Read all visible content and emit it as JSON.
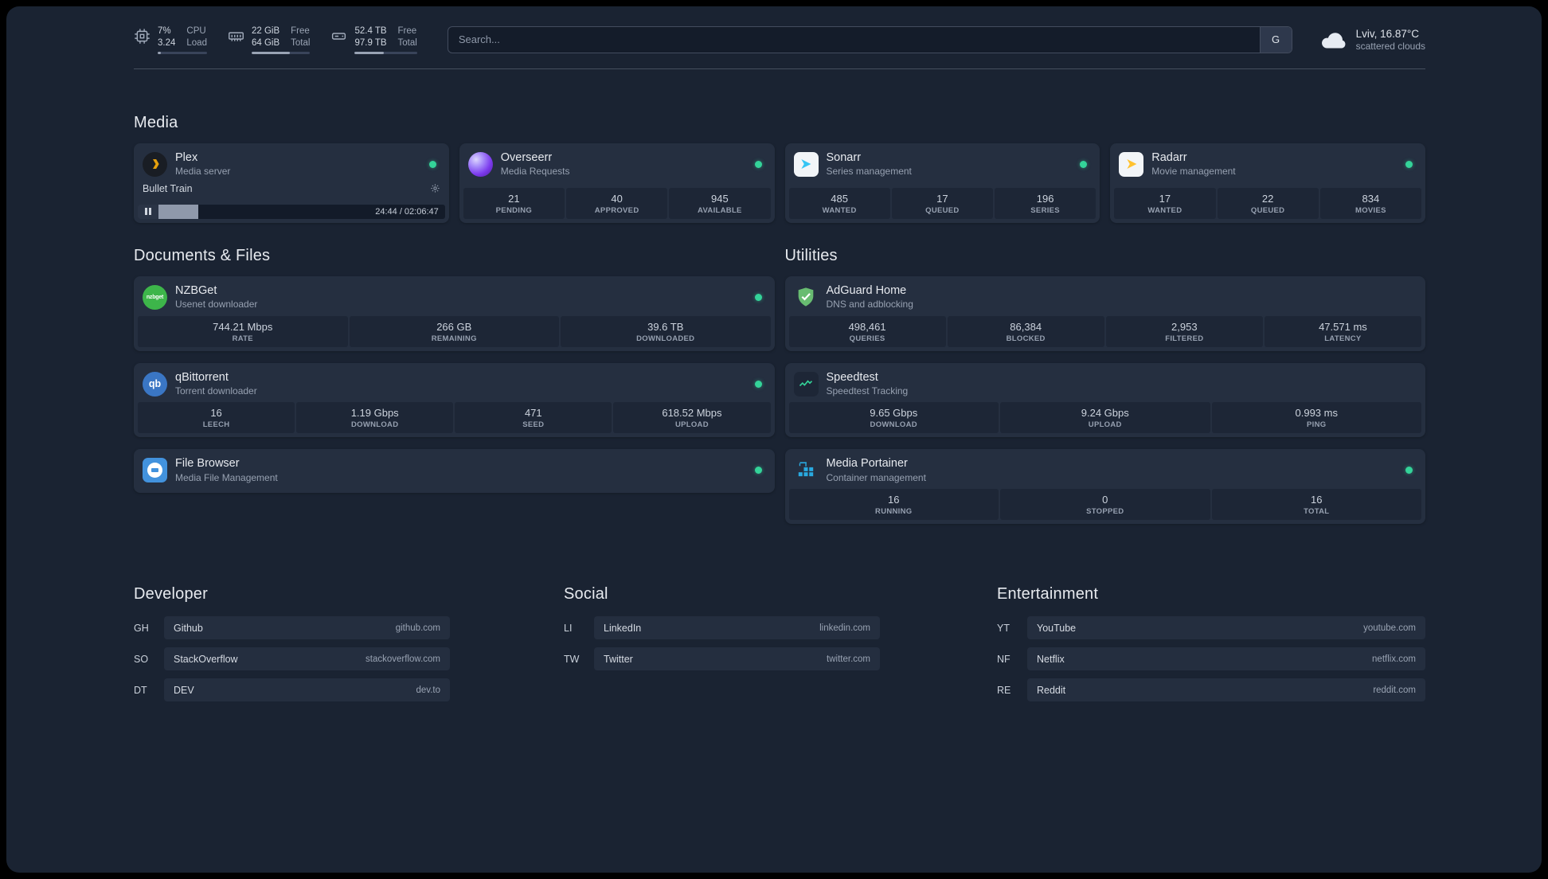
{
  "colors": {
    "status_online": "#34d399",
    "accent_plex": "#e5a00d",
    "accent_radarr": "#ffc230",
    "accent_sonarr": "#35c5f4",
    "accent_adguard": "#68bc71",
    "accent_portainer": "#29aae1",
    "accent_nzbget": "#3db54a",
    "accent_qbittorrent": "#3a76c4",
    "accent_filebrowser": "#4292dd"
  },
  "topbar": {
    "cpu": {
      "value_top": "7%",
      "value_bottom": "3.24",
      "label_top": "CPU",
      "label_bottom": "Load",
      "percent": 7
    },
    "memory": {
      "value_top": "22 GiB",
      "value_bottom": "64 GiB",
      "label_top": "Free",
      "label_bottom": "Total",
      "percent": 65
    },
    "disk": {
      "value_top": "52.4 TB",
      "value_bottom": "97.9 TB",
      "label_top": "Free",
      "label_bottom": "Total",
      "percent": 46
    },
    "search": {
      "placeholder": "Search...",
      "provider_button": "G"
    },
    "weather": {
      "location": "Lviv, 16.87°C",
      "condition": "scattered clouds"
    }
  },
  "sections": {
    "media": "Media",
    "documents": "Documents & Files",
    "utilities": "Utilities"
  },
  "services": {
    "plex": {
      "name": "Plex",
      "desc": "Media server",
      "now_playing": "Bullet Train",
      "elapsed": "24:44 / 02:06:47",
      "progress_percent": 19
    },
    "overseerr": {
      "name": "Overseerr",
      "desc": "Media Requests",
      "stats": [
        {
          "value": "21",
          "label": "PENDING"
        },
        {
          "value": "40",
          "label": "APPROVED"
        },
        {
          "value": "945",
          "label": "AVAILABLE"
        }
      ]
    },
    "sonarr": {
      "name": "Sonarr",
      "desc": "Series management",
      "stats": [
        {
          "value": "485",
          "label": "WANTED"
        },
        {
          "value": "17",
          "label": "QUEUED"
        },
        {
          "value": "196",
          "label": "SERIES"
        }
      ]
    },
    "radarr": {
      "name": "Radarr",
      "desc": "Movie management",
      "stats": [
        {
          "value": "17",
          "label": "WANTED"
        },
        {
          "value": "22",
          "label": "QUEUED"
        },
        {
          "value": "834",
          "label": "MOVIES"
        }
      ]
    },
    "nzbget": {
      "name": "NZBGet",
      "desc": "Usenet downloader",
      "icon_text": "nzbget",
      "stats": [
        {
          "value": "744.21 Mbps",
          "label": "RATE"
        },
        {
          "value": "266 GB",
          "label": "REMAINING"
        },
        {
          "value": "39.6 TB",
          "label": "DOWNLOADED"
        }
      ]
    },
    "qbittorrent": {
      "name": "qBittorrent",
      "desc": "Torrent downloader",
      "icon_text": "qb",
      "stats": [
        {
          "value": "16",
          "label": "LEECH"
        },
        {
          "value": "1.19 Gbps",
          "label": "DOWNLOAD"
        },
        {
          "value": "471",
          "label": "SEED"
        },
        {
          "value": "618.52 Mbps",
          "label": "UPLOAD"
        }
      ]
    },
    "filebrowser": {
      "name": "File Browser",
      "desc": "Media File Management"
    },
    "adguard": {
      "name": "AdGuard Home",
      "desc": "DNS and adblocking",
      "stats": [
        {
          "value": "498,461",
          "label": "QUERIES"
        },
        {
          "value": "86,384",
          "label": "BLOCKED"
        },
        {
          "value": "2,953",
          "label": "FILTERED"
        },
        {
          "value": "47.571 ms",
          "label": "LATENCY"
        }
      ]
    },
    "speedtest": {
      "name": "Speedtest",
      "desc": "Speedtest Tracking",
      "stats": [
        {
          "value": "9.65 Gbps",
          "label": "DOWNLOAD"
        },
        {
          "value": "9.24 Gbps",
          "label": "UPLOAD"
        },
        {
          "value": "0.993 ms",
          "label": "PING"
        }
      ]
    },
    "portainer": {
      "name": "Media Portainer",
      "desc": "Container management",
      "stats": [
        {
          "value": "16",
          "label": "RUNNING"
        },
        {
          "value": "0",
          "label": "STOPPED"
        },
        {
          "value": "16",
          "label": "TOTAL"
        }
      ]
    }
  },
  "bookmarks": {
    "developer": {
      "title": "Developer",
      "items": [
        {
          "abbr": "GH",
          "name": "Github",
          "url": "github.com"
        },
        {
          "abbr": "SO",
          "name": "StackOverflow",
          "url": "stackoverflow.com"
        },
        {
          "abbr": "DT",
          "name": "DEV",
          "url": "dev.to"
        }
      ]
    },
    "social": {
      "title": "Social",
      "items": [
        {
          "abbr": "LI",
          "name": "LinkedIn",
          "url": "linkedin.com"
        },
        {
          "abbr": "TW",
          "name": "Twitter",
          "url": "twitter.com"
        }
      ]
    },
    "entertainment": {
      "title": "Entertainment",
      "items": [
        {
          "abbr": "YT",
          "name": "YouTube",
          "url": "youtube.com"
        },
        {
          "abbr": "NF",
          "name": "Netflix",
          "url": "netflix.com"
        },
        {
          "abbr": "RE",
          "name": "Reddit",
          "url": "reddit.com"
        }
      ]
    }
  }
}
